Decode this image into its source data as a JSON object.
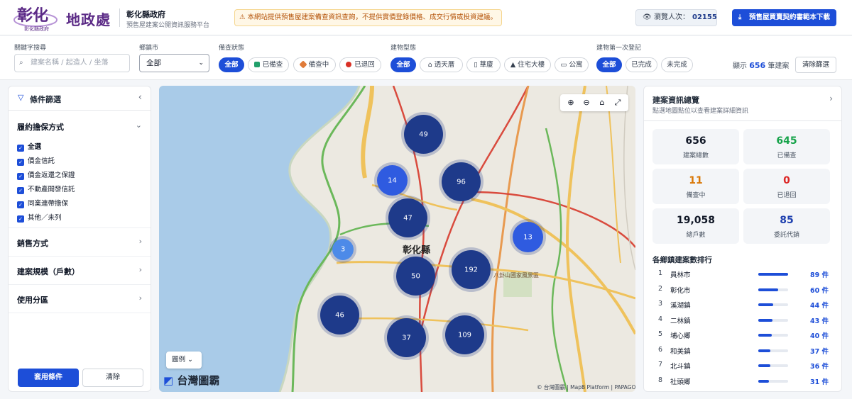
{
  "header": {
    "logo_text": "彰化縣政府",
    "title": "地政處",
    "org": "彰化縣政府",
    "org_sub": "預售屋建案公開資訊服務平台",
    "notice": "⚠ 本網站提供預售屋建案備查資訊查詢，不提供實價登錄價格、成交行情或投資建議。",
    "visits_label": "瀏覽人次：",
    "visits_count": "02155",
    "download_label": "預售屋買賣契約書範本下載"
  },
  "filters": {
    "keyword_label": "關鍵字搜尋",
    "keyword_placeholder": "建案名稱 / 起造人 / 坐落",
    "township_label": "鄉鎮市",
    "township_value": "全部",
    "filing_label": "備查狀態",
    "filing_options": [
      {
        "label": "全部",
        "active": true
      },
      {
        "label": "已備查",
        "active": false,
        "color": "#22a06b"
      },
      {
        "label": "備查中",
        "active": false,
        "color": "#e07b39"
      },
      {
        "label": "已退回",
        "active": false,
        "color": "#d93025"
      }
    ],
    "type_label": "建物型態",
    "type_options": [
      {
        "label": "全部",
        "active": true
      },
      {
        "label": "透天厝",
        "active": false,
        "icon": "house-icon"
      },
      {
        "label": "華廈",
        "active": false,
        "icon": "building-icon"
      },
      {
        "label": "住宅大樓",
        "active": false,
        "icon": "tower-icon"
      },
      {
        "label": "公寓",
        "active": false,
        "icon": "apartment-icon"
      }
    ],
    "registration_label": "建物第一次登記",
    "registration_options": [
      {
        "label": "全部",
        "active": true
      },
      {
        "label": "已完成",
        "active": false
      },
      {
        "label": "未完成",
        "active": false
      }
    ],
    "result_prefix": "顯示",
    "result_count": "656",
    "result_suffix": "筆建案",
    "clear_label": "清除篩選"
  },
  "sidebar": {
    "title": "條件篩選",
    "sections": [
      {
        "title": "履約擔保方式",
        "expanded": true
      },
      {
        "title": "銷售方式",
        "expanded": false
      },
      {
        "title": "建案規模（戶數）",
        "expanded": false
      },
      {
        "title": "使用分區",
        "expanded": false
      }
    ],
    "guarantee_options": [
      "全選",
      "價金信託",
      "價金返還之保證",
      "不動產開發信託",
      "同業連帶擔保",
      "其他／未列"
    ],
    "apply_label": "套用條件",
    "reset_label": "清除"
  },
  "map": {
    "place_label": "彰化縣",
    "poi_label": "八卦山國家風景區",
    "legend_label": "圖例",
    "brand_label": "台灣圖霸",
    "copyright": "© 台灣圖霸 | MapB Platform | PAPAGO",
    "clusters": [
      "49",
      "14",
      "96",
      "47",
      "13",
      "3",
      "50",
      "192",
      "46",
      "37",
      "109"
    ]
  },
  "overview": {
    "title": "建案資訊總覽",
    "subtitle": "點選地圖點位以查看建案詳細資訊",
    "stats": [
      {
        "value": "656",
        "label": "建案總數",
        "color": "#111827"
      },
      {
        "value": "645",
        "label": "已備查",
        "color": "#16a34a"
      },
      {
        "value": "11",
        "label": "備查中",
        "color": "#d97706"
      },
      {
        "value": "0",
        "label": "已退回",
        "color": "#dc2626"
      },
      {
        "value": "19,058",
        "label": "總戶數",
        "color": "#111827"
      },
      {
        "value": "85",
        "label": "委託代銷",
        "color": "#1e40af"
      }
    ],
    "ranking_title": "各鄉鎮建案數排行",
    "ranking": [
      {
        "rank": "1",
        "name": "員林市",
        "count": "89 件",
        "value": 89
      },
      {
        "rank": "2",
        "name": "彰化市",
        "count": "60 件",
        "value": 60
      },
      {
        "rank": "3",
        "name": "溪湖鎮",
        "count": "44 件",
        "value": 44
      },
      {
        "rank": "4",
        "name": "二林鎮",
        "count": "43 件",
        "value": 43
      },
      {
        "rank": "5",
        "name": "埔心鄉",
        "count": "40 件",
        "value": 40
      },
      {
        "rank": "6",
        "name": "和美鎮",
        "count": "37 件",
        "value": 37
      },
      {
        "rank": "7",
        "name": "北斗鎮",
        "count": "36 件",
        "value": 36
      },
      {
        "rank": "8",
        "name": "社頭鄉",
        "count": "31 件",
        "value": 31
      }
    ]
  }
}
